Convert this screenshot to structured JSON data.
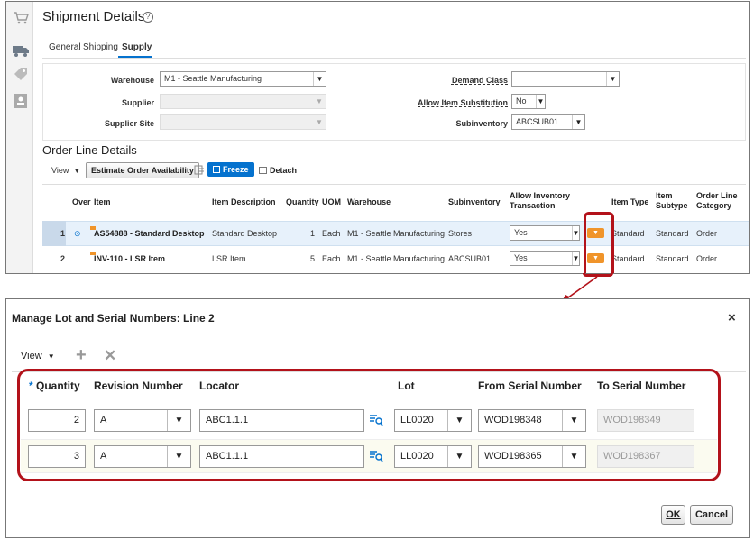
{
  "shipment": {
    "title": "Shipment Details",
    "help_icon": "help-circle-icon",
    "tabs": [
      {
        "label": "General",
        "active": false
      },
      {
        "label": "Shipping",
        "active": false
      },
      {
        "label": "Supply",
        "active": true
      }
    ],
    "fields": {
      "warehouse_label": "Warehouse",
      "warehouse_value": "M1 - Seattle Manufacturing",
      "supplier_label": "Supplier",
      "supplier_value": "",
      "supplier_site_label": "Supplier Site",
      "supplier_site_value": "",
      "demand_class_label": "Demand Class",
      "demand_class_value": "",
      "allow_sub_label": "Allow Item Substitution",
      "allow_sub_value": "No",
      "subinventory_label": "Subinventory",
      "subinventory_value": "ABCSUB01"
    },
    "order_lines": {
      "title": "Order Line Details",
      "view_label": "View",
      "estimate_label": "Estimate Order Availability",
      "freeze_label": "Freeze",
      "detach_label": "Detach",
      "columns": [
        "Over",
        "Item",
        "Item Description",
        "Quantity",
        "UOM",
        "Warehouse",
        "Subinventory",
        "Allow Inventory Transaction",
        "Item Type",
        "Item Subtype",
        "Order Line Category"
      ],
      "rows": [
        {
          "line": "1",
          "item": "AS54888 - Standard Desktop",
          "description": "Standard Desktop",
          "quantity": "1",
          "uom": "Each",
          "warehouse": "M1 - Seattle Manufacturing",
          "subinventory": "Stores",
          "allow_transaction": "Yes",
          "item_type": "Standard",
          "item_subtype": "Standard",
          "category": "Order",
          "selected": true
        },
        {
          "line": "2",
          "item": "INV-110 - LSR Item",
          "description": "LSR Item",
          "quantity": "5",
          "uom": "Each",
          "warehouse": "M1 - Seattle Manufacturing",
          "subinventory": "ABCSUB01",
          "allow_transaction": "Yes",
          "item_type": "Standard",
          "item_subtype": "Standard",
          "category": "Order",
          "selected": false
        }
      ]
    }
  },
  "dialog": {
    "title": "Manage Lot and Serial Numbers: Line 2",
    "close_icon": "close-icon",
    "view_label": "View",
    "columns": {
      "required_mark": "*",
      "quantity": "Quantity",
      "revision": "Revision Number",
      "locator": "Locator",
      "lot": "Lot",
      "from_serial": "From Serial Number",
      "to_serial": "To Serial Number"
    },
    "rows": [
      {
        "quantity": "2",
        "revision": "A",
        "locator": "ABC1.1.1",
        "lot": "LL0020",
        "from_serial": "WOD198348",
        "to_serial": "WOD198349"
      },
      {
        "quantity": "3",
        "revision": "A",
        "locator": "ABC1.1.1",
        "lot": "LL0020",
        "from_serial": "WOD198365",
        "to_serial": "WOD198367"
      }
    ],
    "ok_label": "OK",
    "cancel_label": "Cancel"
  },
  "colors": {
    "highlight": "#b3121a",
    "accent_blue": "#0572ce",
    "action_orange": "#f0942a",
    "selected_row": "#e7f1fb",
    "alt_row": "#fbfbf0"
  }
}
